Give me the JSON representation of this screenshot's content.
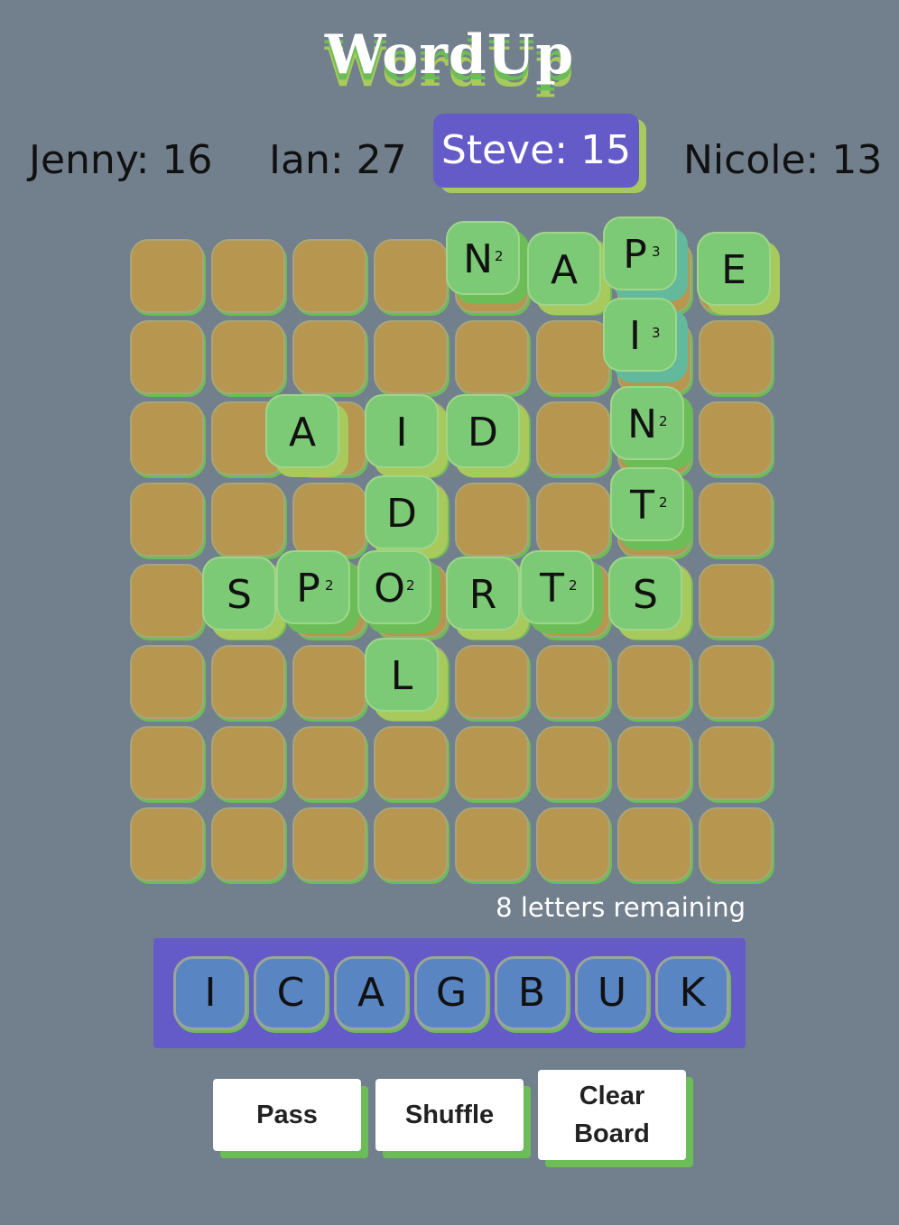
{
  "app": {
    "title": "WordUp"
  },
  "players": [
    {
      "label": "Jenny: 16"
    },
    {
      "label": "Ian: 27"
    },
    {
      "label": "Steve: 15",
      "active": true
    },
    {
      "label": "Nicole: 13"
    }
  ],
  "board": {
    "rows": 8,
    "cols": 8,
    "placed_tiles": [
      {
        "letter": "N",
        "points": "2",
        "row": 0,
        "col": 4
      },
      {
        "letter": "A",
        "points": "",
        "row": 0,
        "col": 5
      },
      {
        "letter": "P",
        "points": "3",
        "row": 0,
        "col": 6
      },
      {
        "letter": "E",
        "points": "",
        "row": 0,
        "col": 7
      },
      {
        "letter": "I",
        "points": "3",
        "row": 1,
        "col": 6
      },
      {
        "letter": "A",
        "points": "",
        "row": 2,
        "col": 2
      },
      {
        "letter": "I",
        "points": "",
        "row": 2,
        "col": 3
      },
      {
        "letter": "D",
        "points": "",
        "row": 2,
        "col": 4
      },
      {
        "letter": "N",
        "points": "2",
        "row": 2,
        "col": 6
      },
      {
        "letter": "D",
        "points": "",
        "row": 3,
        "col": 3
      },
      {
        "letter": "T",
        "points": "2",
        "row": 3,
        "col": 6
      },
      {
        "letter": "S",
        "points": "",
        "row": 4,
        "col": 1
      },
      {
        "letter": "P",
        "points": "2",
        "row": 4,
        "col": 2
      },
      {
        "letter": "O",
        "points": "2",
        "row": 4,
        "col": 3
      },
      {
        "letter": "R",
        "points": "",
        "row": 4,
        "col": 4
      },
      {
        "letter": "T",
        "points": "2",
        "row": 4,
        "col": 5
      },
      {
        "letter": "S",
        "points": "",
        "row": 4,
        "col": 6
      },
      {
        "letter": "L",
        "points": "",
        "row": 5,
        "col": 3
      }
    ]
  },
  "status": {
    "remaining": "8 letters remaining"
  },
  "rack": {
    "letters": [
      "I",
      "C",
      "A",
      "G",
      "B",
      "U",
      "K"
    ]
  },
  "buttons": {
    "pass": "Pass",
    "shuffle": "Shuffle",
    "clear_line1": "Clear",
    "clear_line2": "Board"
  },
  "colors": {
    "background": "#727f8d",
    "active_player": "#645bc9",
    "board_cell": "#b7964f",
    "tile": "#7dca76",
    "rack_tile": "#5985c2",
    "accent_green": "#6cbd58"
  }
}
